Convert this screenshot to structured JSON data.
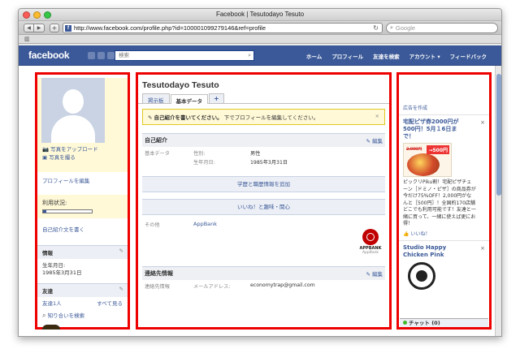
{
  "window": {
    "title": "Facebook | Tesutodayo Tesuto",
    "url": "http://www.facebook.com/profile.php?id=100001099279146&ref=profile",
    "search_placeholder": "Google"
  },
  "fb": {
    "logo": "facebook",
    "search_placeholder": "検索",
    "nav": [
      "ホーム",
      "プロフィール",
      "友達を検索",
      "アカウント ▾",
      "フィードバック"
    ]
  },
  "left": {
    "upload_photo": "写真をアップロード",
    "take_photo": "写真を撮る",
    "edit_profile": "プロフィールを編集",
    "usage_label": "利用状況:",
    "usage_fraction": 0.06,
    "write_intro": "自己紹介文を書く",
    "info_header": "情報",
    "birthday_label": "生年月日:",
    "birthday_value": "1985年3月31日",
    "friends_header": "友達",
    "friends_count": "友達1人",
    "see_all": "すべて見る",
    "find_friends": "知り合いを検索"
  },
  "main": {
    "name": "Tesutodayo Tesuto",
    "tabs": [
      "掲示板",
      "基本データ",
      "+"
    ],
    "notice_bold": "自己紹介を書いてください。",
    "notice_rest": "下でプロフィールを編集してください。",
    "about_header": "自己紹介",
    "edit_label": "編集",
    "basic_label": "基本データ",
    "gender_label": "性別:",
    "gender_value": "男性",
    "bday_label": "生年月日:",
    "bday_value": "1985年3月31日",
    "add_education": "学歴と職歴情報を追加",
    "likes_header": "いいね！と趣味・関心",
    "other_label": "その他",
    "app_name": "AppBank",
    "app_logo_text": "APPBANK",
    "app_logo_sub": "AppBank",
    "contact_header": "連絡先情報",
    "email_label": "連絡先情報",
    "email_field": "メールアドレス:",
    "email_value": "economytrap@gmail.com"
  },
  "right": {
    "create_ad": "広告を作成",
    "ad1_title": "宅配ピザ券2000円が500円！5月１6日まで！",
    "ad1_old_price": "2,000円",
    "ad1_price": "→500円",
    "ad1_body": "ピックリPiku割！宅配ピザチェーン［ドミノ・ピザ］の商品券が今だけ75%OFF！2,000円がなんと［500円］！全国約170店舗どこでも利用可能です！友達と一緒に買って、一緒に使えば更にお得！",
    "ad1_like": "いいね！",
    "ad2_title": "Studio Happy Chicken Pink",
    "chat_label": "チャット (0)"
  }
}
